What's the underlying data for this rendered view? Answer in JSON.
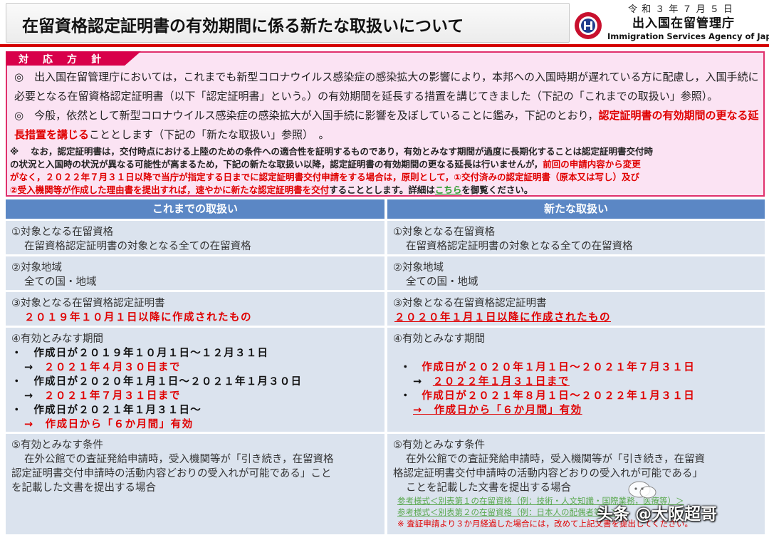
{
  "header": {
    "title": "在留資格認定証明書の有効期間に係る新たな取扱いについて",
    "date": "令 和 ３ 年 ７ 月 ５ 日",
    "agency_ja": "出入国在留管理庁",
    "agency_en": "Immigration Services Agency of Japan",
    "emblem_icon": "agency-emblem",
    "accent_color": "#d40000"
  },
  "policy": {
    "tab_label": "対応方針",
    "para1_line1": "◎　出入国在留管理庁においては，これまでも新型コロナウイルス感染症の感染拡大の影響により，本邦への入国時期が遅れている方に配慮し，入国手続に",
    "para1_line2": "必要となる在留資格認定証明書（以下「認定証明書」という。）の有効期間を延長する措置を講じてきました（下記の「これまでの取扱い」参照）。",
    "para2_line1_a": "◎　今般，依然として新型コロナウイルス感染症の感染拡大が入国手続に影響を及ぼしていることに鑑み，下記のとおり，",
    "para2_line1_red": "認定証明書の有効期間の更なる延",
    "para2_line2_red": "長措置を講じる",
    "para2_line2_b": "こととします（下記の「新たな取扱い」参照）　。",
    "note_line1": "※　 なお，認定証明書は，交付時点における上陸のための条件への適合性を証明するものであり，有効とみなす期間が過度に長期化することは認定証明書交付時",
    "note_line2_a": "の状況と入国時の状況が異なる可能性が高まるため，下記の新たな取扱い以降，認定証明書の有効期間の更なる延長は行いませんが，",
    "note_line2_red": "前回の申請内容から変更",
    "note_line3_red": "がなく，２０２２年７月３１日以降で当庁が指定する日までに認定証明書交付申請をする場合は，原則として，①交付済みの認定証明書（原本又は写し）及び",
    "note_line4_red": "②受入機関等が作成した理由書を提出すれば，速やかに新たな認定証明書を交付",
    "note_line4_b": "することとします。詳細は",
    "note_line4_link": "こちら",
    "note_line4_c": "を御覧ください。"
  },
  "table": {
    "headers": [
      "これまでの取扱い",
      "新たな取扱い"
    ],
    "header_color": "#5b87c5",
    "cell_color": "#dbe3ee",
    "row1": {
      "old": [
        "①対象となる在留資格",
        "在留資格認定証明書の対象となる全ての在留資格"
      ],
      "new": [
        "①対象となる在留資格",
        "在留資格認定証明書の対象となる全ての在留資格"
      ]
    },
    "row2": {
      "old": [
        "②対象地域",
        "全ての国・地域"
      ],
      "new": [
        "②対象地域",
        "全ての国・地域"
      ]
    },
    "row3": {
      "old": [
        "③対象となる在留資格認定証明書",
        "２０１９年１０月１日以降に作成されたもの"
      ],
      "new": [
        "③対象となる在留資格認定証明書",
        "２０２０年１月１日以降に作成されたもの"
      ]
    },
    "row4": {
      "old": [
        "④有効とみなす期間",
        "・　作成日が２０１９年１０月１日～１２月３１日",
        "→",
        "２０２１年４月３０日まで",
        "・　作成日が２０２０年１月１日～２０２１年１月３０日",
        "→",
        "２０２１年７月３１日まで",
        "・　作成日が２０２１年１月３１日～",
        "→　作成日から「６か月間」有効"
      ],
      "new": [
        "④有効とみなす期間",
        "・",
        "作成日が２０２０年１月１日～２０２１年７月３１日",
        "→",
        "２０２２年１月３１日まで",
        "・",
        "作成日が２０２１年８月１日～２０２２年１月３１日",
        "→　作成日から「６か月間」有効"
      ]
    },
    "row5": {
      "old": [
        "⑤有効とみなす条件",
        "在外公館での査証発給申請時，受入機関等が「引き続き，在留資格",
        "認定証明書交付申請時の活動内容どおりの受入れが可能である」こと",
        "を記載した文書を提出する場合"
      ],
      "new": [
        "⑤有効とみなす条件",
        "在外公館での査証発給申請時，受入機関等が「引き続き，在留資",
        "格認定証明書交付申請時の活動内容どおりの受入れが可能である」",
        "ことを記載した文書を提出する場合",
        "参考様式＜別表第１の在留資格（例：技術・人文知識・国際業務，医療等）＞",
        "参考様式＜別表第２の在留資格（例：日本人の配偶者等）＞",
        "※ 査証申請より３か月経過した場合には，改めて上記文書を提出してください。"
      ]
    }
  },
  "watermark": "头条 @大阪超哥"
}
